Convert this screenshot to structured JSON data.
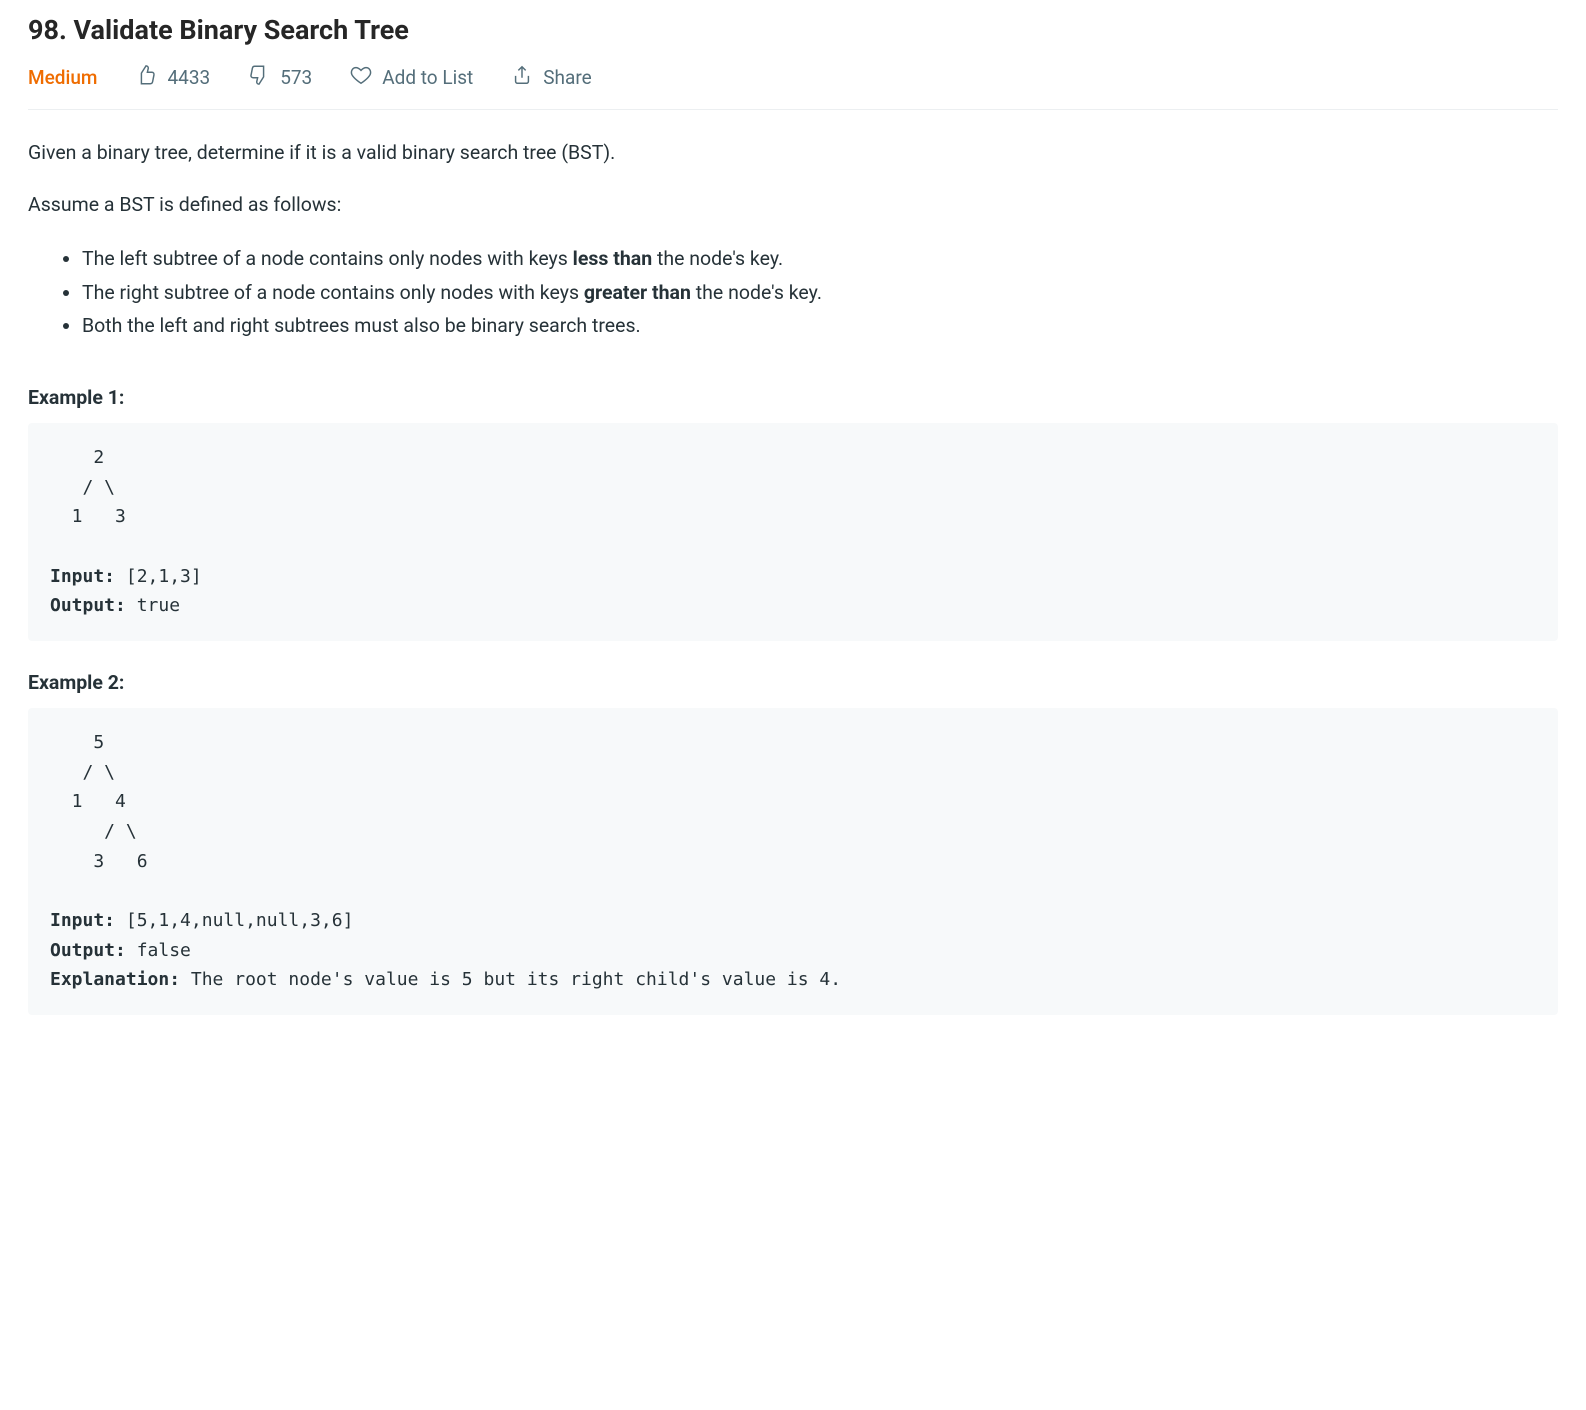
{
  "title": "98. Validate Binary Search Tree",
  "meta": {
    "difficulty": "Medium",
    "likes": "4433",
    "dislikes": "573",
    "add_to_list": "Add to List",
    "share": "Share"
  },
  "content": {
    "intro": "Given a binary tree, determine if it is a valid binary search tree (BST).",
    "assume": "Assume a BST is defined as follows:",
    "rules": [
      {
        "pre": "The left subtree of a node contains only nodes with keys ",
        "bold": "less than",
        "post": " the node's key."
      },
      {
        "pre": "The right subtree of a node contains only nodes with keys ",
        "bold": "greater than",
        "post": " the node's key."
      },
      {
        "pre": "Both the left and right subtrees must also be binary search trees.",
        "bold": "",
        "post": ""
      }
    ]
  },
  "examples": [
    {
      "heading": "Example 1:",
      "tree": "    2\n   / \\\n  1   3",
      "input_label": "Input:",
      "input": " [2,1,3]",
      "output_label": "Output:",
      "output": " true",
      "explanation_label": "",
      "explanation": ""
    },
    {
      "heading": "Example 2:",
      "tree": "    5\n   / \\\n  1   4\n     / \\\n    3   6",
      "input_label": "Input:",
      "input": " [5,1,4,null,null,3,6]",
      "output_label": "Output:",
      "output": " false",
      "explanation_label": "Explanation:",
      "explanation": " The root node's value is 5 but its right child's value is 4."
    }
  ]
}
